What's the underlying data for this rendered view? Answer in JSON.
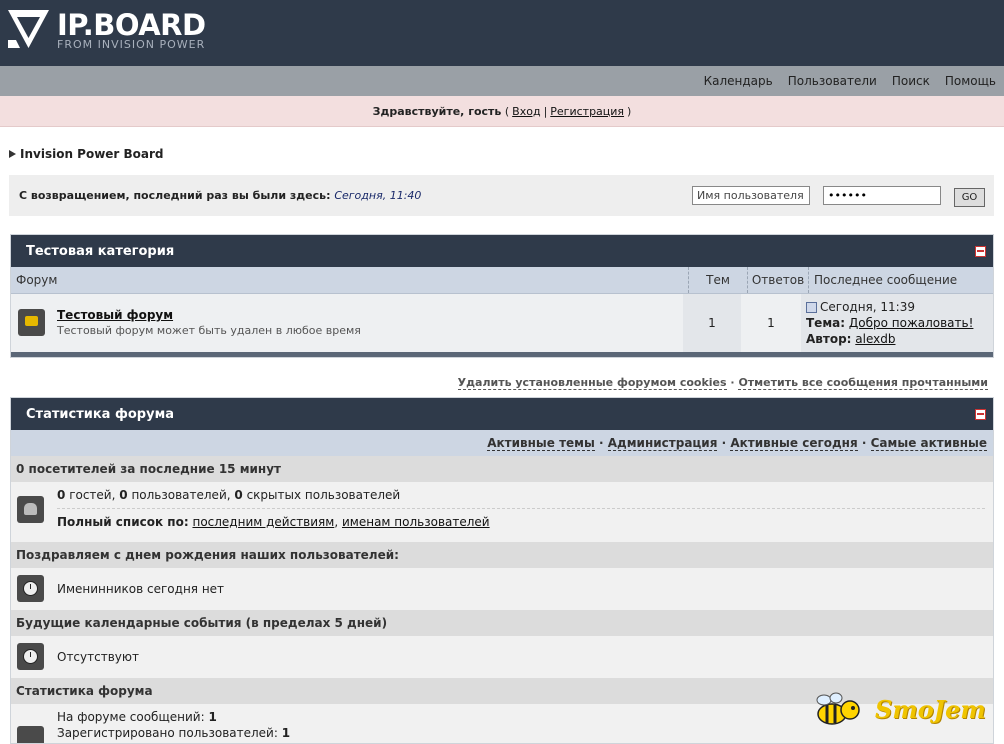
{
  "header": {
    "logo_title": "IP.BOARD",
    "logo_subtitle": "FROM INVISION POWER"
  },
  "nav": {
    "items": [
      "Календарь",
      "Пользователи",
      "Поиск",
      "Помощь"
    ]
  },
  "welcome": {
    "greeting": "Здравствуйте, гость",
    "open_paren": "(",
    "login": "Вход",
    "sep": "|",
    "register": "Регистрация",
    "close_paren": ")"
  },
  "breadcrumb": "Invision Power Board",
  "loginbar": {
    "message": "С возвращением, последний раз вы были здесь:",
    "last_visit": "Сегодня, 11:40",
    "username_value": "Имя пользователя",
    "password_value": "••••••",
    "go_label": "GO"
  },
  "category": {
    "title": "Тестовая категория",
    "columns": {
      "forum": "Форум",
      "topics": "Тем",
      "replies": "Ответов",
      "last": "Последнее сообщение"
    },
    "forums": [
      {
        "name": "Тестовый форум",
        "description": "Тестовый форум может быть удален в любое время",
        "topics": "1",
        "replies": "1",
        "last_date": "Сегодня, 11:39",
        "topic_label": "Тема:",
        "topic_title": "Добро пожаловать!",
        "author_label": "Автор:",
        "author": "alexdb"
      }
    ]
  },
  "board_links": {
    "delete_cookies": "Удалить установленные форумом cookies",
    "sep": "·",
    "mark_read": "Отметить все сообщения прочтанными"
  },
  "stats": {
    "title": "Статистика форума",
    "links": [
      "Активные темы",
      "Администрация",
      "Активные сегодня",
      "Самые активные"
    ],
    "link_sep": "·",
    "online_header": "0 посетителей за последние 15 минут",
    "online": {
      "guests_n": "0",
      "guests_t": "гостей,",
      "users_n": "0",
      "users_t": "пользователей,",
      "hidden_n": "0",
      "hidden_t": "скрытых пользователей"
    },
    "full_list_label": "Полный список по:",
    "full_list_by_action": "последним действиям",
    "full_list_comma": ",",
    "full_list_by_name": "именам пользователей",
    "birthday_header": "Поздравляем с днем рождения наших пользователей:",
    "birthday_text": "Именинников сегодня нет",
    "events_header": "Будущие календарные события (в пределах 5 дней)",
    "events_text": "Отсутствуют",
    "forumstats_header": "Статистика форума",
    "posts_label": "На форуме сообщений:",
    "posts_value": "1",
    "members_label": "Зарегистрировано пользователей:",
    "members_value": "1"
  },
  "watermark": "SmoJem",
  "colors": {
    "header_bg": "#2f3a4a",
    "nav_bg": "#9aa0a6",
    "welcome_bg": "#f3dfdf",
    "colhead_bg": "#cdd6e3"
  }
}
